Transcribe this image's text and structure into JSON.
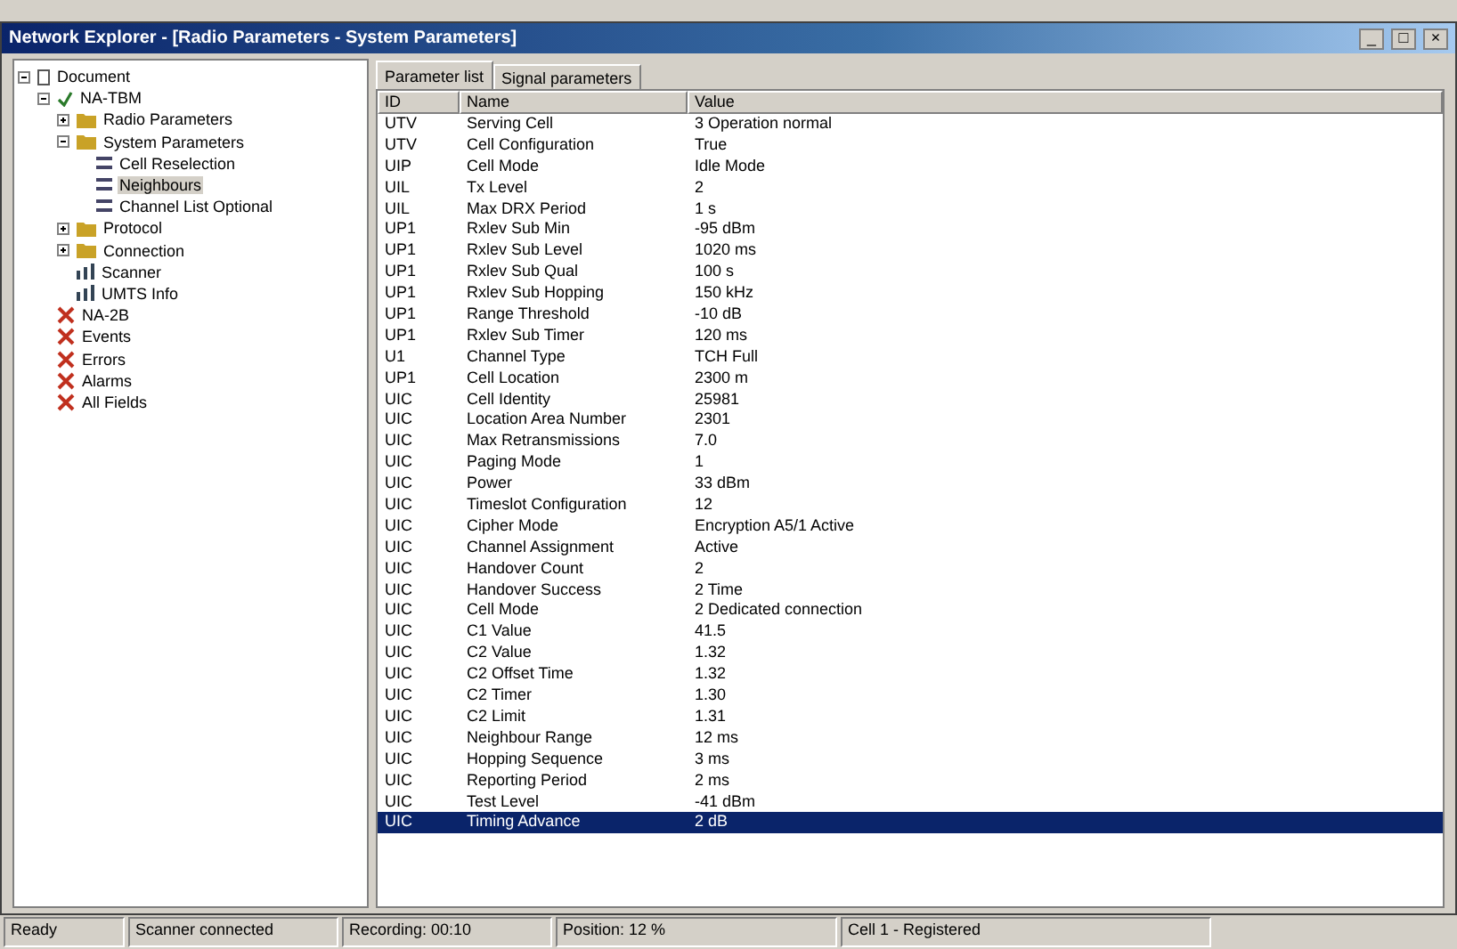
{
  "window": {
    "title": "Network Explorer - [Radio Parameters - System Parameters]",
    "controls": [
      "_",
      "□",
      "×"
    ]
  },
  "tree": [
    {
      "label": "Document",
      "expanded": true,
      "kind": "doc",
      "children": [
        {
          "label": "NA-TBM",
          "kind": "check",
          "expanded": true,
          "children": [
            {
              "label": "Radio Parameters",
              "kind": "folder",
              "expanded": false,
              "selected": false
            },
            {
              "label": "System Parameters",
              "kind": "folder",
              "expanded": true,
              "selected": false,
              "children": [
                {
                  "label": "Cell Reselection",
                  "kind": "item",
                  "selected": false
                },
                {
                  "label": "Neighbours",
                  "kind": "item",
                  "selected": true
                },
                {
                  "label": "Channel List Optional",
                  "kind": "item",
                  "selected": false
                }
              ]
            },
            {
              "label": "Protocol",
              "kind": "folder",
              "expanded": false,
              "selected": false
            },
            {
              "label": "Connection",
              "kind": "folder",
              "expanded": false,
              "selected": false
            },
            {
              "label": "Scanner",
              "kind": "chart",
              "selected": false
            },
            {
              "label": "UMTS Info",
              "kind": "chart",
              "selected": false
            }
          ]
        },
        {
          "label": "NA-2B",
          "kind": "red",
          "selected": false
        },
        {
          "label": "Events",
          "kind": "red",
          "selected": false
        },
        {
          "label": "Errors",
          "kind": "red",
          "selected": false
        },
        {
          "label": "Alarms",
          "kind": "red",
          "selected": false
        },
        {
          "label": "All Fields",
          "kind": "red",
          "selected": false
        }
      ]
    }
  ],
  "tabs": [
    {
      "label": "Parameter list",
      "selected": true
    },
    {
      "label": "Signal parameters",
      "selected": false
    }
  ],
  "table": {
    "columns": [
      "ID",
      "Name",
      "Value"
    ],
    "rows": [
      {
        "id": "UTV",
        "name": "Serving Cell",
        "value": "3 Operation normal",
        "selected": false
      },
      {
        "id": "UTV",
        "name": "Cell Configuration",
        "value": "True",
        "selected": false
      },
      {
        "id": "UIP",
        "name": "Cell Mode",
        "value": "Idle Mode",
        "selected": false
      },
      {
        "id": "UIL",
        "name": "Tx Level",
        "value": "2",
        "selected": false
      },
      {
        "id": "UIL",
        "name": "Max DRX Period",
        "value": "1 s",
        "selected": false
      },
      {
        "id": "UP1",
        "name": "Rxlev Sub Min",
        "value": "-95 dBm",
        "selected": false
      },
      {
        "id": "UP1",
        "name": "Rxlev Sub Level",
        "value": "1020 ms",
        "selected": false
      },
      {
        "id": "UP1",
        "name": "Rxlev Sub Qual",
        "value": "100 s",
        "selected": false
      },
      {
        "id": "UP1",
        "name": "Rxlev Sub Hopping",
        "value": "150 kHz",
        "selected": false
      },
      {
        "id": "UP1",
        "name": "Range Threshold",
        "value": "-10 dB",
        "selected": false
      },
      {
        "id": "UP1",
        "name": "Rxlev Sub Timer",
        "value": "120 ms",
        "selected": false
      },
      {
        "id": "U1",
        "name": "Channel Type",
        "value": "TCH Full",
        "selected": false
      },
      {
        "id": "UP1",
        "name": "Cell Location",
        "value": "2300 m",
        "selected": false
      },
      {
        "id": "UIC",
        "name": "Cell Identity",
        "value": "25981",
        "selected": false
      },
      {
        "id": "UIC",
        "name": "Location Area Number",
        "value": "2301",
        "selected": false
      },
      {
        "id": "UIC",
        "name": "Max Retransmissions",
        "value": "7.0",
        "selected": false
      },
      {
        "id": "UIC",
        "name": "Paging Mode",
        "value": "1",
        "selected": false
      },
      {
        "id": "UIC",
        "name": "Power",
        "value": "33 dBm",
        "selected": false
      },
      {
        "id": "UIC",
        "name": "Timeslot Configuration",
        "value": "12",
        "selected": false
      },
      {
        "id": "UIC",
        "name": "Cipher Mode",
        "value": "Encryption A5/1 Active",
        "selected": false
      },
      {
        "id": "UIC",
        "name": "Channel Assignment",
        "value": "Active",
        "selected": false
      },
      {
        "id": "UIC",
        "name": "Handover Count",
        "value": "2",
        "selected": false
      },
      {
        "id": "UIC",
        "name": "Handover Success",
        "value": "2 Time",
        "selected": false
      },
      {
        "id": "UIC",
        "name": "Cell Mode",
        "value": "2 Dedicated connection",
        "selected": false
      },
      {
        "id": "UIC",
        "name": "C1 Value",
        "value": "41.5",
        "selected": false
      },
      {
        "id": "UIC",
        "name": "C2 Value",
        "value": "1.32",
        "selected": false
      },
      {
        "id": "UIC",
        "name": "C2 Offset Time",
        "value": "1.32",
        "selected": false
      },
      {
        "id": "UIC",
        "name": "C2 Timer",
        "value": "1.30",
        "selected": false
      },
      {
        "id": "UIC",
        "name": "C2 Limit",
        "value": "1.31",
        "selected": false
      },
      {
        "id": "UIC",
        "name": "Neighbour Range",
        "value": "12 ms",
        "selected": false
      },
      {
        "id": "UIC",
        "name": "Hopping Sequence",
        "value": "3 ms",
        "selected": false
      },
      {
        "id": "UIC",
        "name": "Reporting Period",
        "value": "2 ms",
        "selected": false
      },
      {
        "id": "UIC",
        "name": "Test Level",
        "value": "-41 dBm",
        "selected": false
      },
      {
        "id": "UIC",
        "name": "Timing Advance",
        "value": "2 dB",
        "selected": true
      }
    ]
  },
  "status_bar": [
    "Ready",
    "Scanner connected",
    "Recording: 00:10",
    "Position: 12 %",
    "Cell 1 - Registered"
  ]
}
